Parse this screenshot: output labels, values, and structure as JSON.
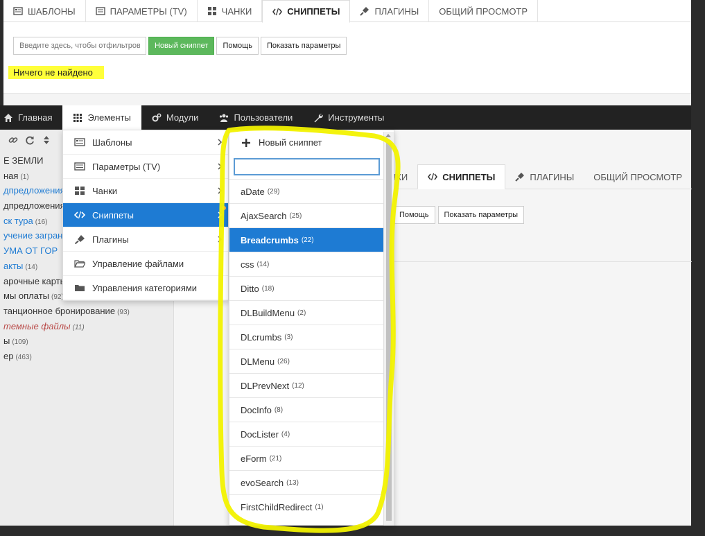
{
  "top": {
    "tabs": [
      {
        "label": "ШАБЛОНЫ",
        "icon": "templates-icon"
      },
      {
        "label": "ПАРАМЕТРЫ (TV)",
        "icon": "tv-params-icon"
      },
      {
        "label": "ЧАНКИ",
        "icon": "chunks-icon"
      },
      {
        "label": "СНИППЕТЫ",
        "icon": "code-icon",
        "active": true
      },
      {
        "label": "ПЛАГИНЫ",
        "icon": "plug-icon"
      },
      {
        "label": "ОБЩИЙ ПРОСМОТР"
      }
    ],
    "filter_placeholder": "Введите здесь, чтобы отфильтровать",
    "new_snippet_label": "Новый сниппет",
    "help_label": "Помощь",
    "show_params_label": "Показать параметры",
    "not_found": "Ничего не найдено"
  },
  "navbar": {
    "items": [
      {
        "label": "Главная",
        "icon": "home-icon"
      },
      {
        "label": "Элементы",
        "icon": "grid-icon",
        "active": true
      },
      {
        "label": "Модули",
        "icon": "cogs-icon"
      },
      {
        "label": "Пользователи",
        "icon": "users-icon"
      },
      {
        "label": "Инструменты",
        "icon": "wrench-icon"
      }
    ]
  },
  "tree": {
    "rows": [
      {
        "label": "Е ЗЕМЛИ",
        "count": "",
        "style": "header"
      },
      {
        "label": "ная",
        "count": "(1)",
        "style": "normal"
      },
      {
        "label": "дпредложения",
        "count": "",
        "style": "blue"
      },
      {
        "label": "дпредложения",
        "count": "",
        "style": "normal"
      },
      {
        "label": "ск тура",
        "count": "(16)",
        "style": "blue"
      },
      {
        "label": "учение загран",
        "count": "",
        "style": "blue"
      },
      {
        "label": "УМА ОТ ГОР",
        "count": "",
        "style": "blue"
      },
      {
        "label": "акты",
        "count": "(14)",
        "style": "blue"
      },
      {
        "label": "арочные карть",
        "count": "",
        "style": "normal"
      },
      {
        "label": "мы оплаты",
        "count": "(92)",
        "style": "normal"
      },
      {
        "label": "танционное бронирование",
        "count": "(93)",
        "style": "normal"
      },
      {
        "label": "темные файлы",
        "count": "(11)",
        "style": "red"
      },
      {
        "label": "ы",
        "count": "(109)",
        "style": "normal"
      },
      {
        "label": "ер",
        "count": "(463)",
        "style": "normal"
      }
    ]
  },
  "content": {
    "tabs": [
      {
        "label": "ЧАНКИ"
      },
      {
        "label": "СНИППЕТЫ",
        "icon": "code-icon",
        "active": true
      },
      {
        "label": "ПЛАГИНЫ",
        "icon": "plug-icon"
      },
      {
        "label": "ОБЩИЙ ПРОСМОТР"
      }
    ],
    "help_label": "Помощь",
    "show_params_label": "Показать параметры"
  },
  "menu": {
    "items": [
      {
        "label": "Шаблоны",
        "icon": "templates-icon",
        "submenu": true
      },
      {
        "label": "Параметры (TV)",
        "icon": "tv-params-icon",
        "submenu": true
      },
      {
        "label": "Чанки",
        "icon": "chunks-icon",
        "submenu": true
      },
      {
        "label": "Сниппеты",
        "icon": "code-icon",
        "submenu": true,
        "active": true
      },
      {
        "label": "Плагины",
        "icon": "plug-icon",
        "submenu": true
      },
      {
        "label": "Управление файлами",
        "icon": "folder-open-icon",
        "submenu": false
      },
      {
        "label": "Управления категориями",
        "icon": "folder-icon",
        "submenu": false
      }
    ]
  },
  "submenu": {
    "new_label": "Новый сниппет",
    "filter_value": "",
    "items": [
      {
        "label": "aDate",
        "count": "(29)"
      },
      {
        "label": "AjaxSearch",
        "count": "(25)"
      },
      {
        "label": "Breadcrumbs",
        "count": "(22)",
        "active": true
      },
      {
        "label": "css",
        "count": "(14)"
      },
      {
        "label": "Ditto",
        "count": "(18)"
      },
      {
        "label": "DLBuildMenu",
        "count": "(2)"
      },
      {
        "label": "DLcrumbs",
        "count": "(3)"
      },
      {
        "label": "DLMenu",
        "count": "(26)"
      },
      {
        "label": "DLPrevNext",
        "count": "(12)"
      },
      {
        "label": "DocInfo",
        "count": "(8)"
      },
      {
        "label": "DocLister",
        "count": "(4)"
      },
      {
        "label": "eForm",
        "count": "(21)"
      },
      {
        "label": "evoSearch",
        "count": "(13)"
      },
      {
        "label": "FirstChildRedirect",
        "count": "(1)"
      }
    ]
  },
  "colors": {
    "highlight_yellow": "#ffff3a",
    "annotation_yellow": "#f2f200",
    "accent_blue": "#1e7bd3",
    "green_button": "#5cb85c",
    "navbar": "#222222"
  }
}
